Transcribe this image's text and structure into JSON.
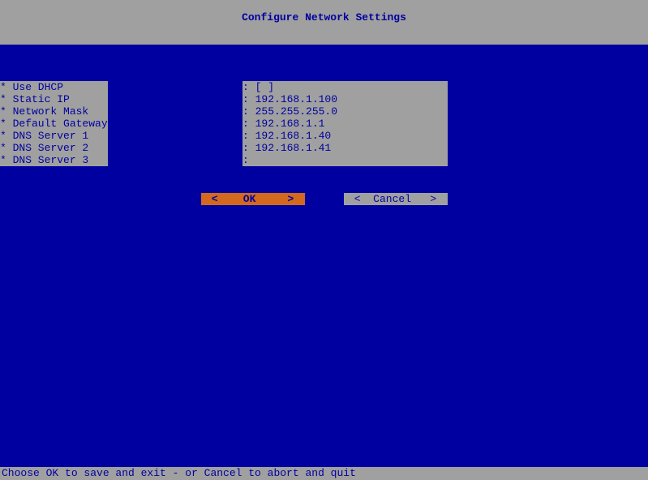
{
  "title": "Configure Network Settings",
  "fields": [
    {
      "label": "* Use DHCP",
      "value": "[ ]"
    },
    {
      "label": "* Static IP",
      "value": "192.168.1.100"
    },
    {
      "label": "* Network Mask",
      "value": "255.255.255.0"
    },
    {
      "label": "* Default Gateway",
      "value": "192.168.1.1"
    },
    {
      "label": "* DNS Server 1",
      "value": "192.168.1.40"
    },
    {
      "label": "* DNS Server 2",
      "value": "192.168.1.41"
    },
    {
      "label": "* DNS Server 3",
      "value": ""
    }
  ],
  "buttons": {
    "ok": "<    OK     >",
    "cancel": "<  Cancel   >"
  },
  "statusBar": "Choose OK to save and exit - or Cancel to abort and quit"
}
